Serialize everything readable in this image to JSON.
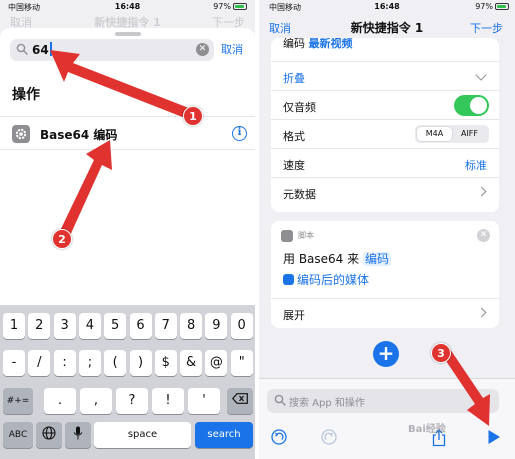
{
  "left": {
    "status": {
      "carrier": "中国移动",
      "time": "16:48",
      "battery": "97%"
    },
    "ghost_nav": {
      "left": "取消",
      "title": "新快捷指令 1",
      "right": "下一步"
    },
    "search": {
      "query": "64"
    },
    "cancel_label": "取消",
    "section_title": "操作",
    "action": {
      "label": "Base64 编码"
    },
    "keyboard": {
      "row1": [
        "1",
        "2",
        "3",
        "4",
        "5",
        "6",
        "7",
        "8",
        "9",
        "0"
      ],
      "row2": [
        "-",
        "/",
        ":",
        ";",
        "(",
        ")",
        "$",
        "&",
        "@",
        "\""
      ],
      "shift_label": "#+=",
      "row3": [
        ".",
        ",",
        "?",
        "!",
        "'"
      ],
      "abc_label": "ABC",
      "space_label": "space",
      "search_label": "search"
    }
  },
  "right": {
    "status": {
      "carrier": "中国移动",
      "time": "16:48",
      "battery": "97%"
    },
    "nav": {
      "cancel": "取消",
      "title": "新快捷指令 1",
      "next": "下一步"
    },
    "cut_row": {
      "label": "编码",
      "token": "最新视频"
    },
    "fold_label": "折叠",
    "audio_only_label": "仅音频",
    "format": {
      "label": "格式",
      "options": [
        "M4A",
        "AIFF"
      ]
    },
    "speed": {
      "label": "速度",
      "value": "标准"
    },
    "metadata_label": "元数据",
    "script_card": {
      "header": "脚本",
      "line1_prefix": "用 Base64 来",
      "line1_token": "编码",
      "line2_token": "编码后的媒体",
      "expand_label": "展开"
    },
    "search_placeholder": "搜索 App 和操作"
  },
  "annotations": {
    "badge1": "1",
    "badge2": "2",
    "badge3": "3",
    "marker_color": "#e0322f"
  },
  "watermark": "Bai经验"
}
